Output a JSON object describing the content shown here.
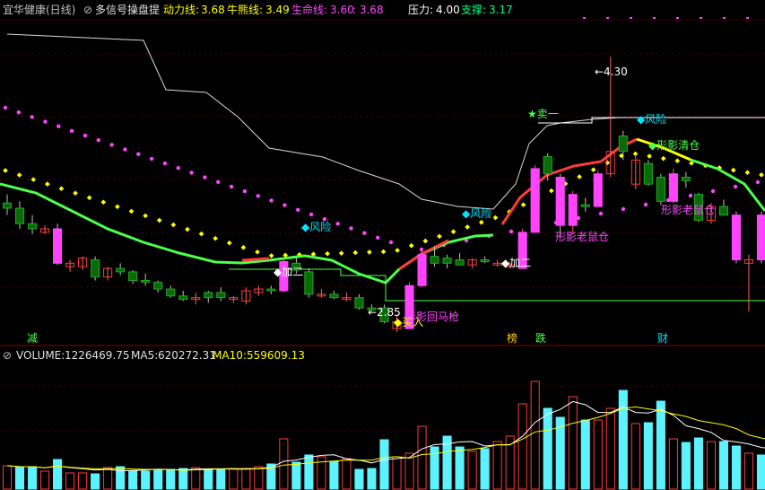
{
  "header": {
    "stock_name": "宜华健康(日线)",
    "indicator_name": "多信号操盘提",
    "dongli_label": "动力线:",
    "dongli_value": "3.68",
    "niuxiong_label": "牛熊线:",
    "niuxiong_value": "3.49",
    "shengming_label": "生命线:",
    "shengming_value": "3.60",
    "extra_value": "3.68",
    "yali_label": "压力:",
    "yali_value": "4.00",
    "zhicheng_label": "支撑:",
    "zhicheng_value": "3.17"
  },
  "volume_header": {
    "volume_label": "VOLUME:",
    "volume_value": "1226469.75",
    "ma5_label": "MA5:",
    "ma5_value": "620272.31",
    "ma10_label": "MA10:",
    "ma10_value": "559609.13"
  },
  "annotations": {
    "risk1": "◆风险",
    "add1": "◆加二",
    "price_low": "←2.85",
    "buy": "◆买入",
    "horse": "形影回马枪",
    "risk2": "◆风险",
    "add2": "◆加二",
    "sell1": "★卖一",
    "price_high": "←4.30",
    "risk3": "◆风险",
    "clear": "◆形影清仓",
    "rat1": "形影老鼠仓",
    "rat2": "形影老鼠仓"
  },
  "markers": {
    "jian": "减",
    "bang": "榜",
    "die": "跌",
    "cai": "财"
  },
  "colors": {
    "up": "#ff3b3b",
    "down": "#00e5ff",
    "bull": "#ff3b3b",
    "life": "#4cff4c",
    "pink": "#ff44ff",
    "yellow": "#ffff00",
    "cyan": "#00ffff",
    "volume_bar": "#5cf2ff",
    "gray": "#c0c0c0",
    "bull_area": "#f0f"
  },
  "chart_data": {
    "type": "candlestick",
    "price_range": [
      2.7,
      4.5
    ],
    "candles": [
      {
        "o": 3.45,
        "h": 3.5,
        "l": 3.38,
        "c": 3.42,
        "u": false
      },
      {
        "o": 3.42,
        "h": 3.46,
        "l": 3.3,
        "c": 3.33,
        "u": false
      },
      {
        "o": 3.33,
        "h": 3.38,
        "l": 3.27,
        "c": 3.3,
        "u": false
      },
      {
        "o": 3.3,
        "h": 3.32,
        "l": 3.27,
        "c": 3.28,
        "u": true
      },
      {
        "o": 3.3,
        "h": 3.33,
        "l": 3.09,
        "c": 3.1,
        "u": false
      },
      {
        "o": 3.1,
        "h": 3.12,
        "l": 3.05,
        "c": 3.08,
        "u": true
      },
      {
        "o": 3.08,
        "h": 3.14,
        "l": 3.06,
        "c": 3.13,
        "u": true
      },
      {
        "o": 3.12,
        "h": 3.14,
        "l": 3.0,
        "c": 3.02,
        "u": false
      },
      {
        "o": 3.02,
        "h": 3.08,
        "l": 3.0,
        "c": 3.07,
        "u": true
      },
      {
        "o": 3.07,
        "h": 3.1,
        "l": 3.03,
        "c": 3.05,
        "u": false
      },
      {
        "o": 3.05,
        "h": 3.06,
        "l": 2.98,
        "c": 3.0,
        "u": false
      },
      {
        "o": 3.0,
        "h": 3.04,
        "l": 2.97,
        "c": 2.99,
        "u": false
      },
      {
        "o": 2.99,
        "h": 3.0,
        "l": 2.93,
        "c": 2.95,
        "u": false
      },
      {
        "o": 2.95,
        "h": 2.97,
        "l": 2.9,
        "c": 2.91,
        "u": false
      },
      {
        "o": 2.91,
        "h": 2.94,
        "l": 2.88,
        "c": 2.89,
        "u": false
      },
      {
        "o": 2.89,
        "h": 2.93,
        "l": 2.86,
        "c": 2.9,
        "u": true
      },
      {
        "o": 2.9,
        "h": 2.94,
        "l": 2.87,
        "c": 2.93,
        "u": false
      },
      {
        "o": 2.93,
        "h": 2.96,
        "l": 2.88,
        "c": 2.9,
        "u": false
      },
      {
        "o": 2.89,
        "h": 2.91,
        "l": 2.87,
        "c": 2.9,
        "u": true
      },
      {
        "o": 2.88,
        "h": 2.96,
        "l": 2.86,
        "c": 2.94,
        "u": true
      },
      {
        "o": 2.93,
        "h": 2.97,
        "l": 2.91,
        "c": 2.95,
        "u": true
      },
      {
        "o": 2.95,
        "h": 2.97,
        "l": 2.92,
        "c": 2.94,
        "u": false
      },
      {
        "o": 2.94,
        "h": 3.13,
        "l": 2.93,
        "c": 3.11,
        "u": true
      },
      {
        "o": 3.1,
        "h": 3.13,
        "l": 3.04,
        "c": 3.06,
        "u": false
      },
      {
        "o": 3.05,
        "h": 3.07,
        "l": 2.9,
        "c": 2.92,
        "u": false
      },
      {
        "o": 2.92,
        "h": 2.95,
        "l": 2.9,
        "c": 2.92,
        "u": true
      },
      {
        "o": 2.92,
        "h": 2.94,
        "l": 2.89,
        "c": 2.9,
        "u": false
      },
      {
        "o": 2.9,
        "h": 2.93,
        "l": 2.88,
        "c": 2.9,
        "u": true
      },
      {
        "o": 2.9,
        "h": 2.92,
        "l": 2.83,
        "c": 2.84,
        "u": false
      },
      {
        "o": 2.84,
        "h": 2.86,
        "l": 2.82,
        "c": 2.84,
        "u": false
      },
      {
        "o": 2.84,
        "h": 2.86,
        "l": 2.75,
        "c": 2.76,
        "u": false
      },
      {
        "o": 2.76,
        "h": 2.8,
        "l": 2.7,
        "c": 2.72,
        "u": true
      },
      {
        "o": 2.72,
        "h": 2.99,
        "l": 2.72,
        "c": 2.97,
        "u": true
      },
      {
        "o": 2.97,
        "h": 3.17,
        "l": 2.96,
        "c": 3.15,
        "u": true
      },
      {
        "o": 3.14,
        "h": 3.2,
        "l": 3.08,
        "c": 3.1,
        "u": false
      },
      {
        "o": 3.1,
        "h": 3.15,
        "l": 3.07,
        "c": 3.13,
        "u": false
      },
      {
        "o": 3.12,
        "h": 3.16,
        "l": 3.09,
        "c": 3.09,
        "u": false
      },
      {
        "o": 3.09,
        "h": 3.13,
        "l": 3.07,
        "c": 3.12,
        "u": true
      },
      {
        "o": 3.12,
        "h": 3.14,
        "l": 3.1,
        "c": 3.12,
        "u": false
      },
      {
        "o": 3.1,
        "h": 3.12,
        "l": 3.08,
        "c": 3.09,
        "u": true
      },
      {
        "o": 3.09,
        "h": 3.11,
        "l": 3.07,
        "c": 3.08,
        "u": true
      },
      {
        "o": 3.07,
        "h": 3.3,
        "l": 3.07,
        "c": 3.28,
        "u": true
      },
      {
        "o": 3.28,
        "h": 3.67,
        "l": 3.28,
        "c": 3.65,
        "u": true
      },
      {
        "o": 3.62,
        "h": 3.74,
        "l": 3.58,
        "c": 3.72,
        "u": false
      },
      {
        "o": 3.6,
        "h": 3.62,
        "l": 3.25,
        "c": 3.32,
        "u": false
      },
      {
        "o": 3.32,
        "h": 3.52,
        "l": 3.27,
        "c": 3.5,
        "u": true
      },
      {
        "o": 3.44,
        "h": 3.48,
        "l": 3.4,
        "c": 3.43,
        "u": false
      },
      {
        "o": 3.43,
        "h": 3.64,
        "l": 3.43,
        "c": 3.62,
        "u": true
      },
      {
        "o": 3.62,
        "h": 4.3,
        "l": 3.6,
        "c": 3.75,
        "u": true
      },
      {
        "o": 3.75,
        "h": 3.87,
        "l": 3.7,
        "c": 3.84,
        "u": false
      },
      {
        "o": 3.7,
        "h": 3.73,
        "l": 3.53,
        "c": 3.56,
        "u": true
      },
      {
        "o": 3.56,
        "h": 3.7,
        "l": 3.55,
        "c": 3.68,
        "u": false
      },
      {
        "o": 3.6,
        "h": 3.62,
        "l": 3.44,
        "c": 3.46,
        "u": false
      },
      {
        "o": 3.46,
        "h": 3.65,
        "l": 3.45,
        "c": 3.62,
        "u": true
      },
      {
        "o": 3.6,
        "h": 3.63,
        "l": 3.54,
        "c": 3.58,
        "u": false
      },
      {
        "o": 3.5,
        "h": 3.51,
        "l": 3.34,
        "c": 3.35,
        "u": false
      },
      {
        "o": 3.35,
        "h": 3.45,
        "l": 3.33,
        "c": 3.43,
        "u": true
      },
      {
        "o": 3.43,
        "h": 3.47,
        "l": 3.38,
        "c": 3.38,
        "u": false
      },
      {
        "o": 3.38,
        "h": 3.4,
        "l": 3.1,
        "c": 3.12,
        "u": false
      },
      {
        "o": 3.1,
        "h": 3.15,
        "l": 2.82,
        "c": 3.12,
        "u": true
      },
      {
        "o": 3.12,
        "h": 3.4,
        "l": 3.1,
        "c": 3.38,
        "u": false
      }
    ],
    "volumes": [
      26,
      24,
      25,
      20,
      33,
      18,
      18,
      17,
      24,
      25,
      20,
      20,
      22,
      22,
      23,
      24,
      22,
      22,
      23,
      23,
      25,
      28,
      56,
      30,
      38,
      36,
      31,
      34,
      22,
      23,
      55,
      36,
      40,
      70,
      47,
      59,
      47,
      42,
      45,
      53,
      59,
      95,
      120,
      90,
      80,
      103,
      77,
      77,
      90,
      110,
      73,
      74,
      98,
      56,
      52,
      57,
      53,
      53,
      48,
      40,
      38,
      46
    ],
    "vol_up": [
      true,
      false,
      false,
      true,
      false,
      true,
      true,
      false,
      true,
      false,
      false,
      false,
      false,
      false,
      false,
      true,
      false,
      false,
      true,
      true,
      true,
      false,
      true,
      false,
      false,
      true,
      false,
      true,
      false,
      false,
      false,
      true,
      true,
      true,
      false,
      false,
      false,
      true,
      false,
      true,
      true,
      true,
      true,
      false,
      false,
      true,
      false,
      true,
      true,
      false,
      true,
      false,
      false,
      true,
      false,
      false,
      true,
      false,
      false,
      true,
      false,
      false
    ],
    "volume_range": [
      0,
      140
    ]
  }
}
